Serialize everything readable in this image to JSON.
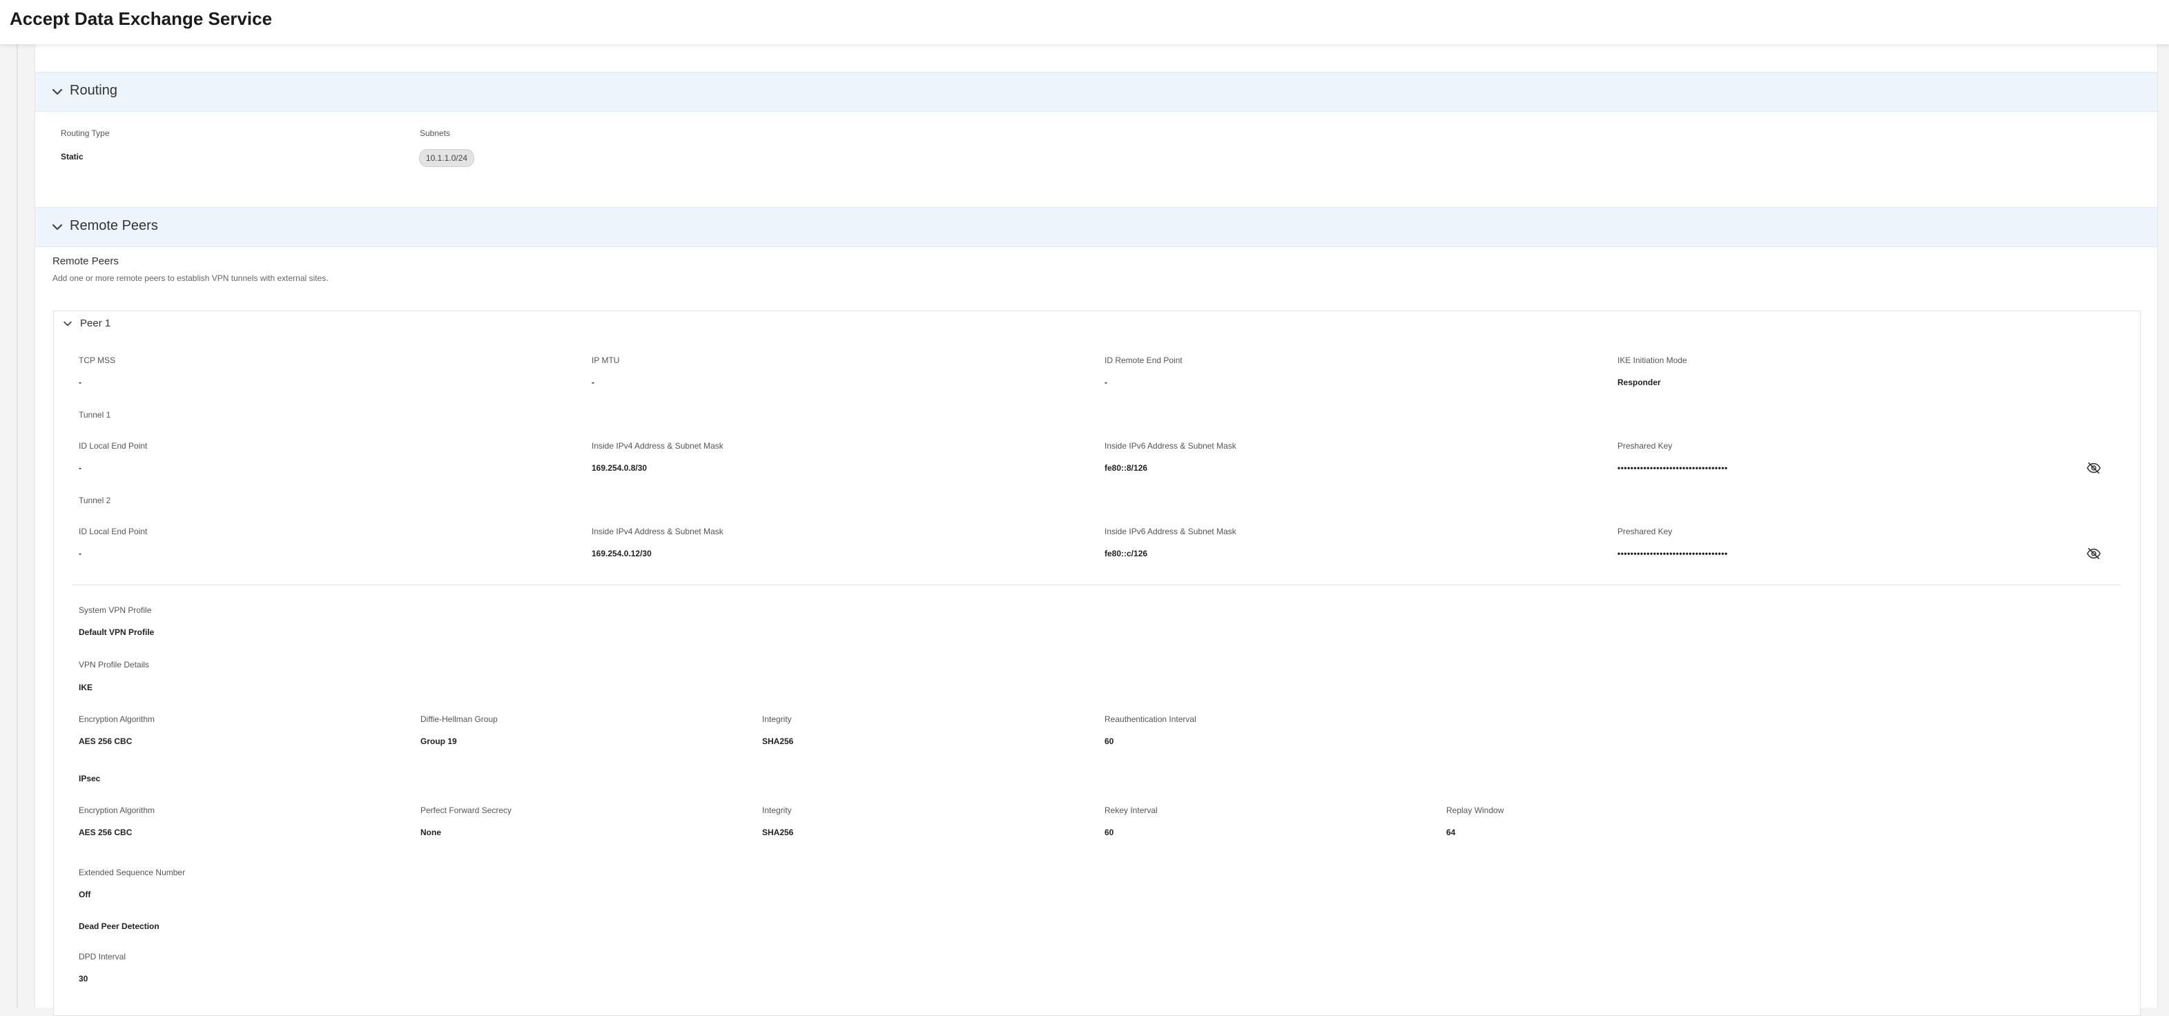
{
  "header": {
    "title": "Accept Data Exchange Service"
  },
  "routing": {
    "section_label": "Routing",
    "routing_type_label": "Routing Type",
    "routing_type_value": "Static",
    "subnets_label": "Subnets",
    "subnets": [
      "10.1.1.0/24"
    ]
  },
  "remote_peers": {
    "section_label": "Remote Peers",
    "subtitle": "Remote Peers",
    "description": "Add one or more remote peers to establish VPN tunnels with external sites.",
    "peer": {
      "title": "Peer 1",
      "tcp_mss_label": "TCP MSS",
      "tcp_mss_value": "-",
      "ip_mtu_label": "IP MTU",
      "ip_mtu_value": "-",
      "id_remote_label": "ID Remote End Point",
      "id_remote_value": "-",
      "ike_mode_label": "IKE Initiation Mode",
      "ike_mode_value": "Responder",
      "tunnels": [
        {
          "title": "Tunnel 1",
          "id_local_label": "ID Local End Point",
          "id_local_value": "-",
          "ipv4_label": "Inside IPv4 Address & Subnet Mask",
          "ipv4_value": "169.254.0.8/30",
          "ipv6_label": "Inside IPv6 Address & Subnet Mask",
          "ipv6_value": "fe80::8/126",
          "psk_label": "Preshared Key",
          "psk_value": "••••••••••••••••••••••••••••••••••",
          "eye_icon": "eye-slash-icon"
        },
        {
          "title": "Tunnel 2",
          "id_local_label": "ID Local End Point",
          "id_local_value": "-",
          "ipv4_label": "Inside IPv4 Address & Subnet Mask",
          "ipv4_value": "169.254.0.12/30",
          "ipv6_label": "Inside IPv6 Address & Subnet Mask",
          "ipv6_value": "fe80::c/126",
          "psk_label": "Preshared Key",
          "psk_value": "••••••••••••••••••••••••••••••••••",
          "eye_icon": "eye-slash-icon"
        }
      ],
      "system_vpn_profile_label": "System VPN Profile",
      "system_vpn_profile_value": "Default VPN Profile",
      "vpn_profile_details_label": "VPN Profile Details",
      "ike": {
        "heading": "IKE",
        "enc_label": "Encryption Algorithm",
        "enc_value": "AES 256 CBC",
        "dh_label": "Diffie-Hellman Group",
        "dh_value": "Group 19",
        "integrity_label": "Integrity",
        "integrity_value": "SHA256",
        "reauth_label": "Reauthentication Interval",
        "reauth_value": "60"
      },
      "ipsec": {
        "heading": "IPsec",
        "enc_label": "Encryption Algorithm",
        "enc_value": "AES 256 CBC",
        "pfs_label": "Perfect Forward Secrecy",
        "pfs_value": "None",
        "integrity_label": "Integrity",
        "integrity_value": "SHA256",
        "rekey_label": "Rekey Interval",
        "rekey_value": "60",
        "replay_label": "Replay Window",
        "replay_value": "64"
      },
      "esn_label": "Extended Sequence Number",
      "esn_value": "Off",
      "dpd_heading": "Dead Peer Detection",
      "dpd_interval_label": "DPD Interval",
      "dpd_interval_value": "30"
    }
  }
}
